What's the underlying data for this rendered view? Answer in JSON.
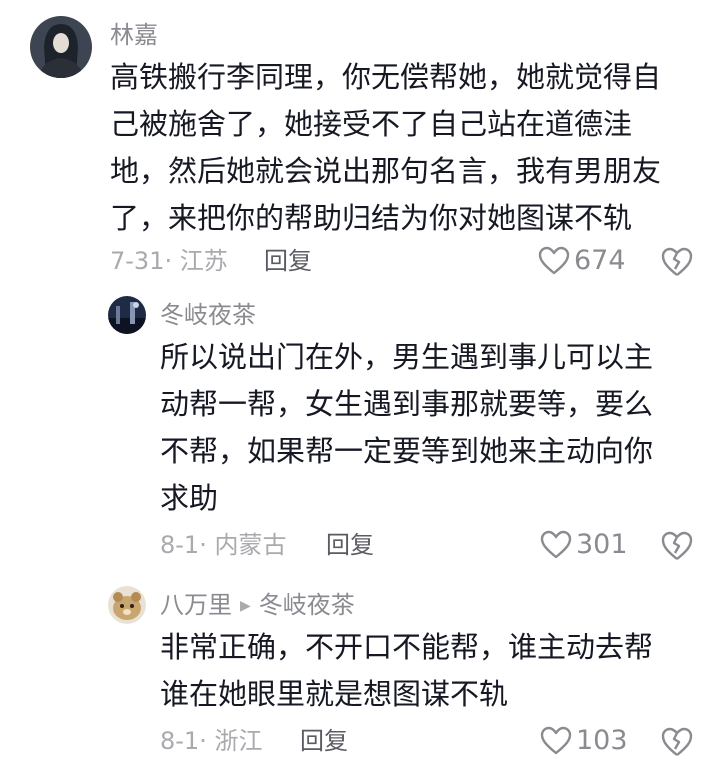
{
  "comments": [
    {
      "username": "林嘉",
      "lines": [
        "高铁搬行李同理，你无偿帮她，她就觉得自",
        "己被施舍了，她接受不了自己站在道德洼",
        "地，然后她就会说出那句名言，我有男朋友",
        "了，来把你的帮助归结为你对她图谋不轨"
      ],
      "meta": "7-31· 江苏",
      "reply_label": "回复",
      "likes": "674"
    },
    {
      "username": "冬岐夜茶",
      "lines": [
        "所以说出门在外，男生遇到事儿可以主",
        "动帮一帮，女生遇到事那就要等，要么",
        "不帮，如果帮一定要等到她来主动向你",
        "求助"
      ],
      "meta": "8-1· 内蒙古",
      "reply_label": "回复",
      "likes": "301"
    },
    {
      "username": "八万里",
      "reply_to": "冬岐夜茶",
      "lines": [
        "非常正确，不开口不能帮，谁主动去帮",
        "谁在她眼里就是想图谋不轨"
      ],
      "meta": "8-1· 浙江",
      "reply_label": "回复",
      "likes": "103"
    }
  ],
  "icons": {
    "like": "heart-outline-icon",
    "dislike": "broken-heart-icon"
  },
  "colors": {
    "text": "#161823",
    "muted": "#8a8b91",
    "meta": "#a9aaae"
  }
}
